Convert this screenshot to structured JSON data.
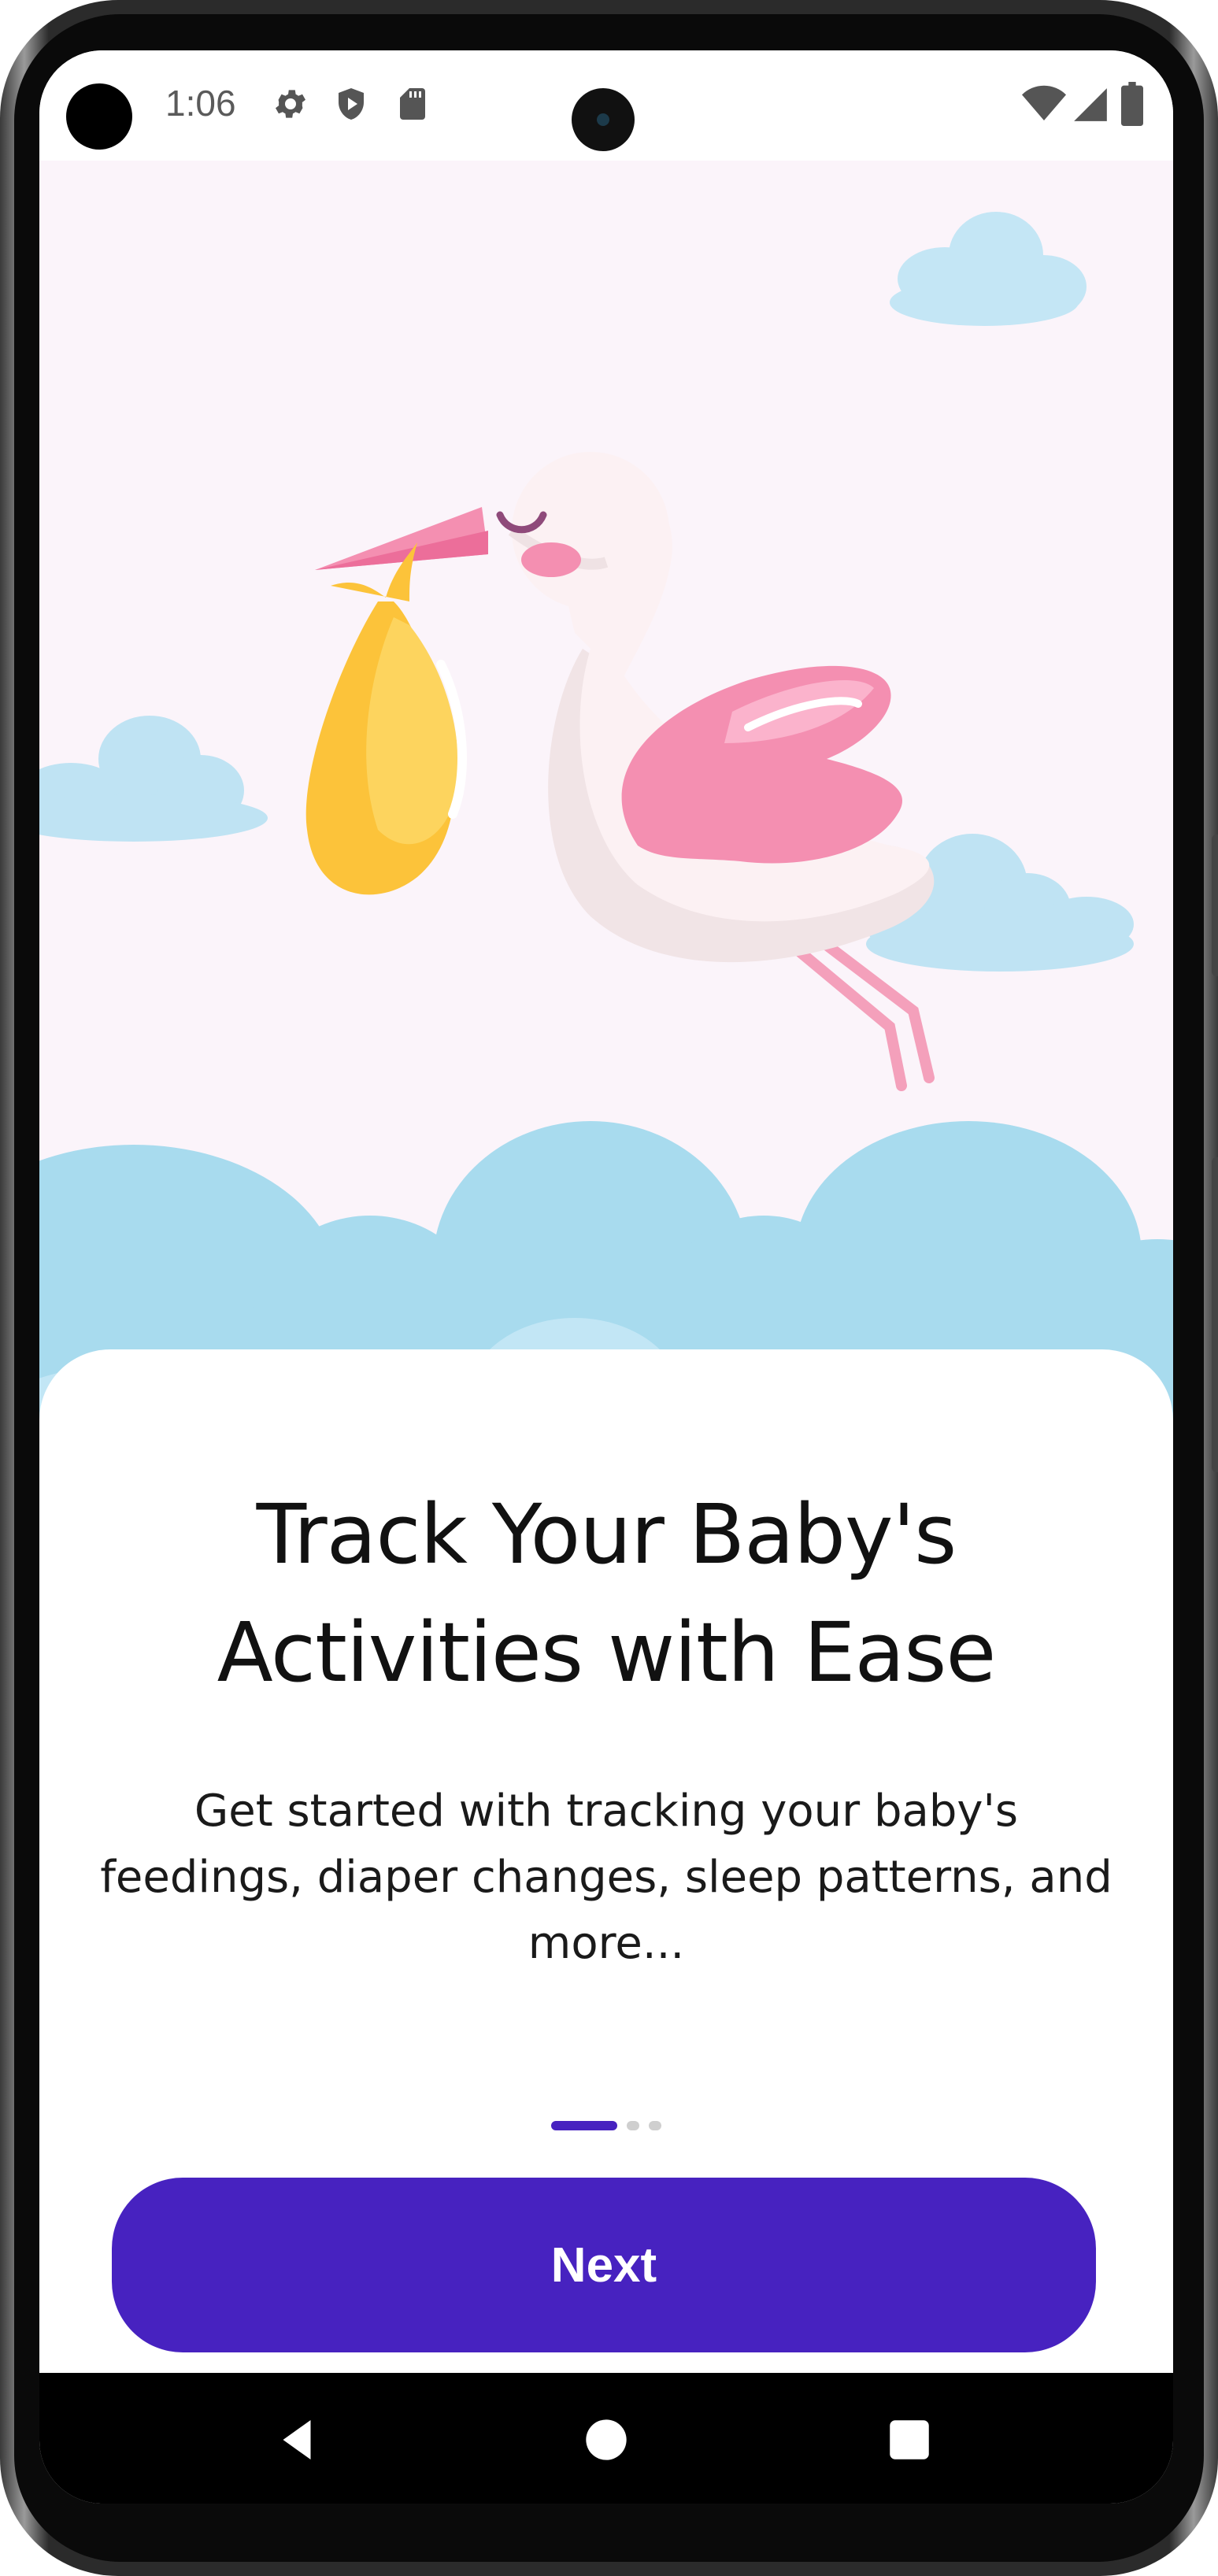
{
  "status_bar": {
    "time": "1:06",
    "left_icons": [
      "settings-icon",
      "play-protect-icon",
      "sd-card-icon"
    ],
    "right_icons": [
      "wifi-icon",
      "signal-icon",
      "battery-icon"
    ]
  },
  "onboarding": {
    "title": "Track Your Baby's Activities with Ease",
    "subtitle": "Get started with tracking your baby's feedings, diaper changes, sleep patterns, and more...",
    "page_indicator": {
      "current": 1,
      "total": 3
    },
    "next_label": "Next"
  },
  "illustration": {
    "subject": "stork-carrying-bundle",
    "colors": {
      "background": "#fbf4fa",
      "cloud": "#a8dbee",
      "wing": "#f48fb1",
      "bundle": "#fdd05a",
      "beak": "#f06292"
    }
  },
  "nav_bar": {
    "buttons": [
      "back-icon",
      "home-icon",
      "recents-icon"
    ]
  },
  "colors": {
    "accent": "#4722c0"
  }
}
